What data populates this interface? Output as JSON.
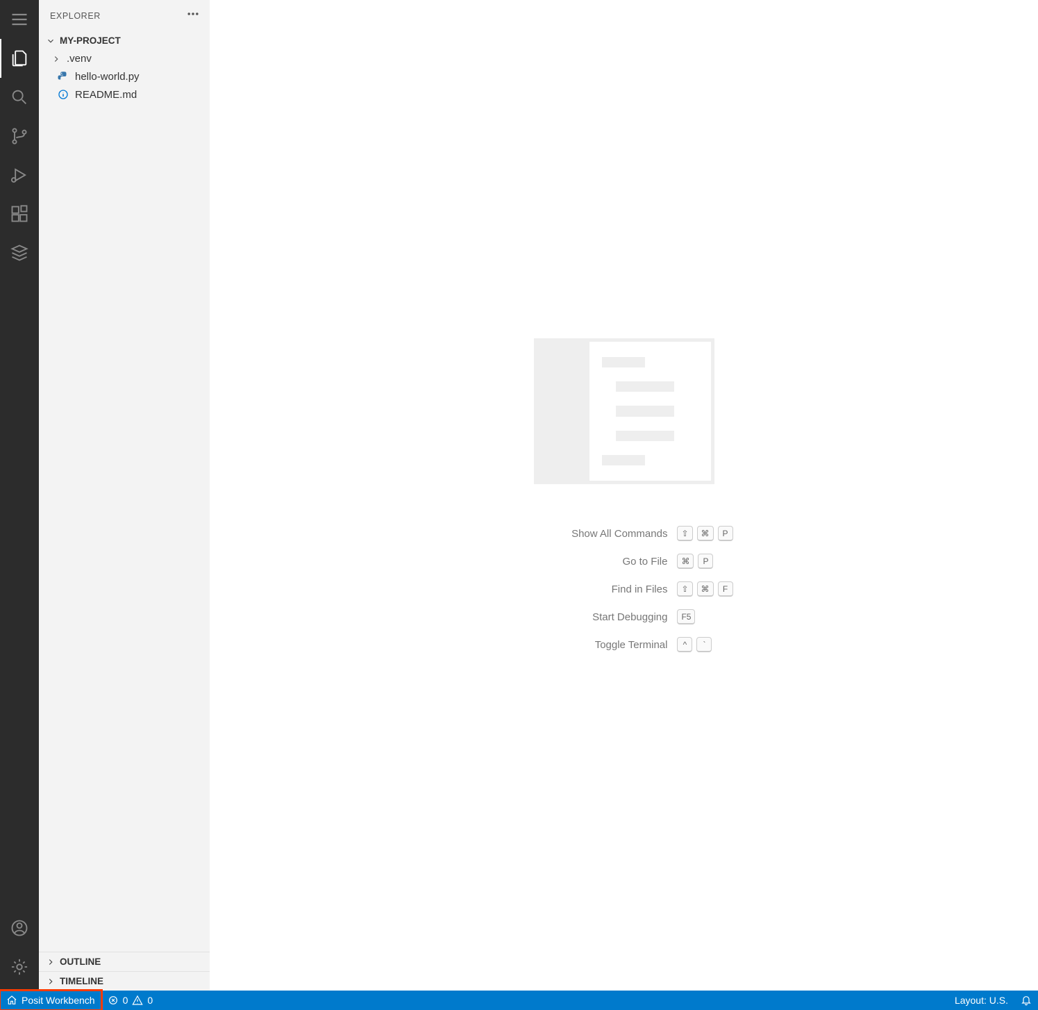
{
  "sidebar": {
    "title": "EXPLORER",
    "project": "MY-PROJECT",
    "tree": {
      "folder1": ".venv",
      "file1": "hello-world.py",
      "file2": "README.md"
    },
    "outline": "OUTLINE",
    "timeline": "TIMELINE"
  },
  "editor": {
    "shortcuts": {
      "show_all": {
        "label": "Show All Commands",
        "keys": [
          "⇧",
          "⌘",
          "P"
        ]
      },
      "goto_file": {
        "label": "Go to File",
        "keys": [
          "⌘",
          "P"
        ]
      },
      "find_in_files": {
        "label": "Find in Files",
        "keys": [
          "⇧",
          "⌘",
          "F"
        ]
      },
      "start_debug": {
        "label": "Start Debugging",
        "keys": [
          "F5"
        ]
      },
      "toggle_terminal": {
        "label": "Toggle Terminal",
        "keys": [
          "^",
          "`"
        ]
      }
    }
  },
  "status": {
    "workbench": "Posit Workbench",
    "errors": "0",
    "warnings": "0",
    "layout": "Layout: U.S."
  }
}
